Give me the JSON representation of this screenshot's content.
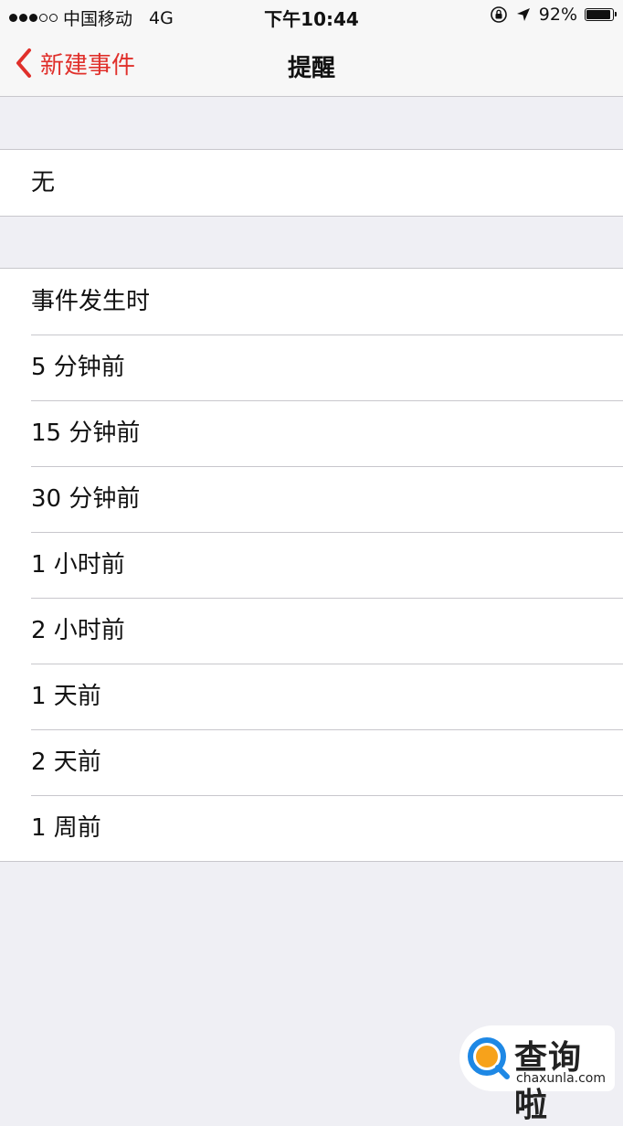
{
  "status_bar": {
    "carrier": "中国移动",
    "network": "4G",
    "time": "下午10:44",
    "battery_percent": "92%",
    "battery_level": 0.92,
    "signal_strength": 3,
    "signal_max": 5
  },
  "nav": {
    "back_label": "新建事件",
    "title": "提醒"
  },
  "groups": [
    {
      "items": [
        "无"
      ]
    },
    {
      "items": [
        "事件发生时",
        "5 分钟前",
        "15 分钟前",
        "30 分钟前",
        "1 小时前",
        "2 小时前",
        "1 天前",
        "2 天前",
        "1 周前"
      ]
    }
  ],
  "watermark": {
    "text": "查询啦",
    "url": "chaxunla.com"
  },
  "colors": {
    "accent": "#e0302b",
    "background": "#efeff4",
    "cell": "#ffffff",
    "separator": "#c8c7cc",
    "watermark_orange": "#f7a21b",
    "watermark_blue": "#1e88e5"
  },
  "icons": [
    "lock-rotation-icon",
    "location-arrow-icon",
    "battery-icon",
    "back-chevron-icon",
    "signal-dots-icon"
  ]
}
